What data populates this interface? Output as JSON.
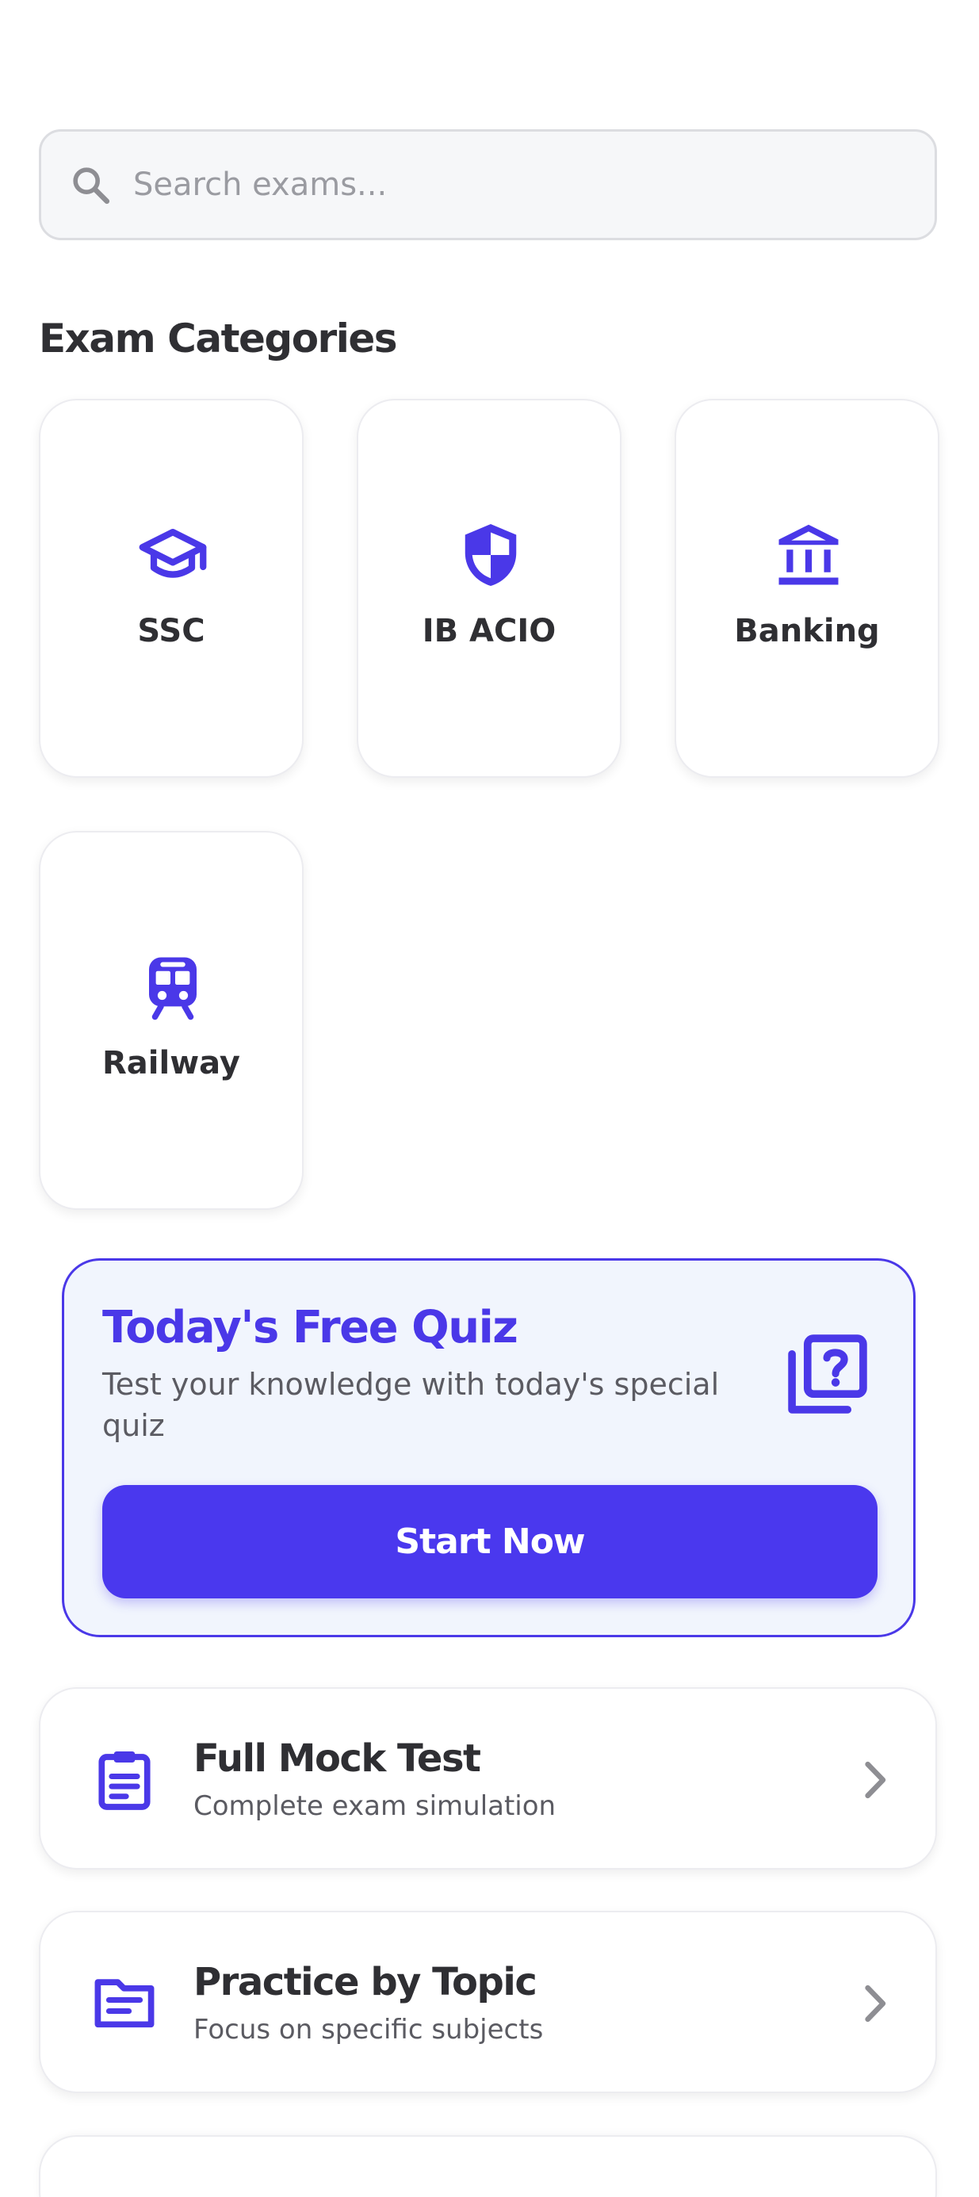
{
  "search": {
    "placeholder": "Search exams...",
    "value": ""
  },
  "categories_section": {
    "title": "Exam Categories",
    "items": [
      {
        "label": "SSC",
        "icon": "graduation-cap-icon"
      },
      {
        "label": "IB ACIO",
        "icon": "shield-icon"
      },
      {
        "label": "Banking",
        "icon": "bank-icon"
      },
      {
        "label": "Railway",
        "icon": "train-icon"
      }
    ]
  },
  "quiz": {
    "title": "Today's Free Quiz",
    "description": "Test your knowledge with today's special quiz",
    "button_label": "Start Now",
    "icon": "quiz-icon"
  },
  "list": [
    {
      "title": "Full Mock Test",
      "subtitle": "Complete exam simulation",
      "icon": "clipboard-icon"
    },
    {
      "title": "Practice by Topic",
      "subtitle": "Focus on specific subjects",
      "icon": "topic-icon"
    }
  ],
  "colors": {
    "accent": "#4a38e8",
    "background": "#ffffff",
    "quiz_background": "#f1f5fd",
    "text_primary": "#2f2f33",
    "text_secondary": "#5b5b62",
    "placeholder": "#9a9ba1",
    "chevron": "#8e8e93"
  }
}
